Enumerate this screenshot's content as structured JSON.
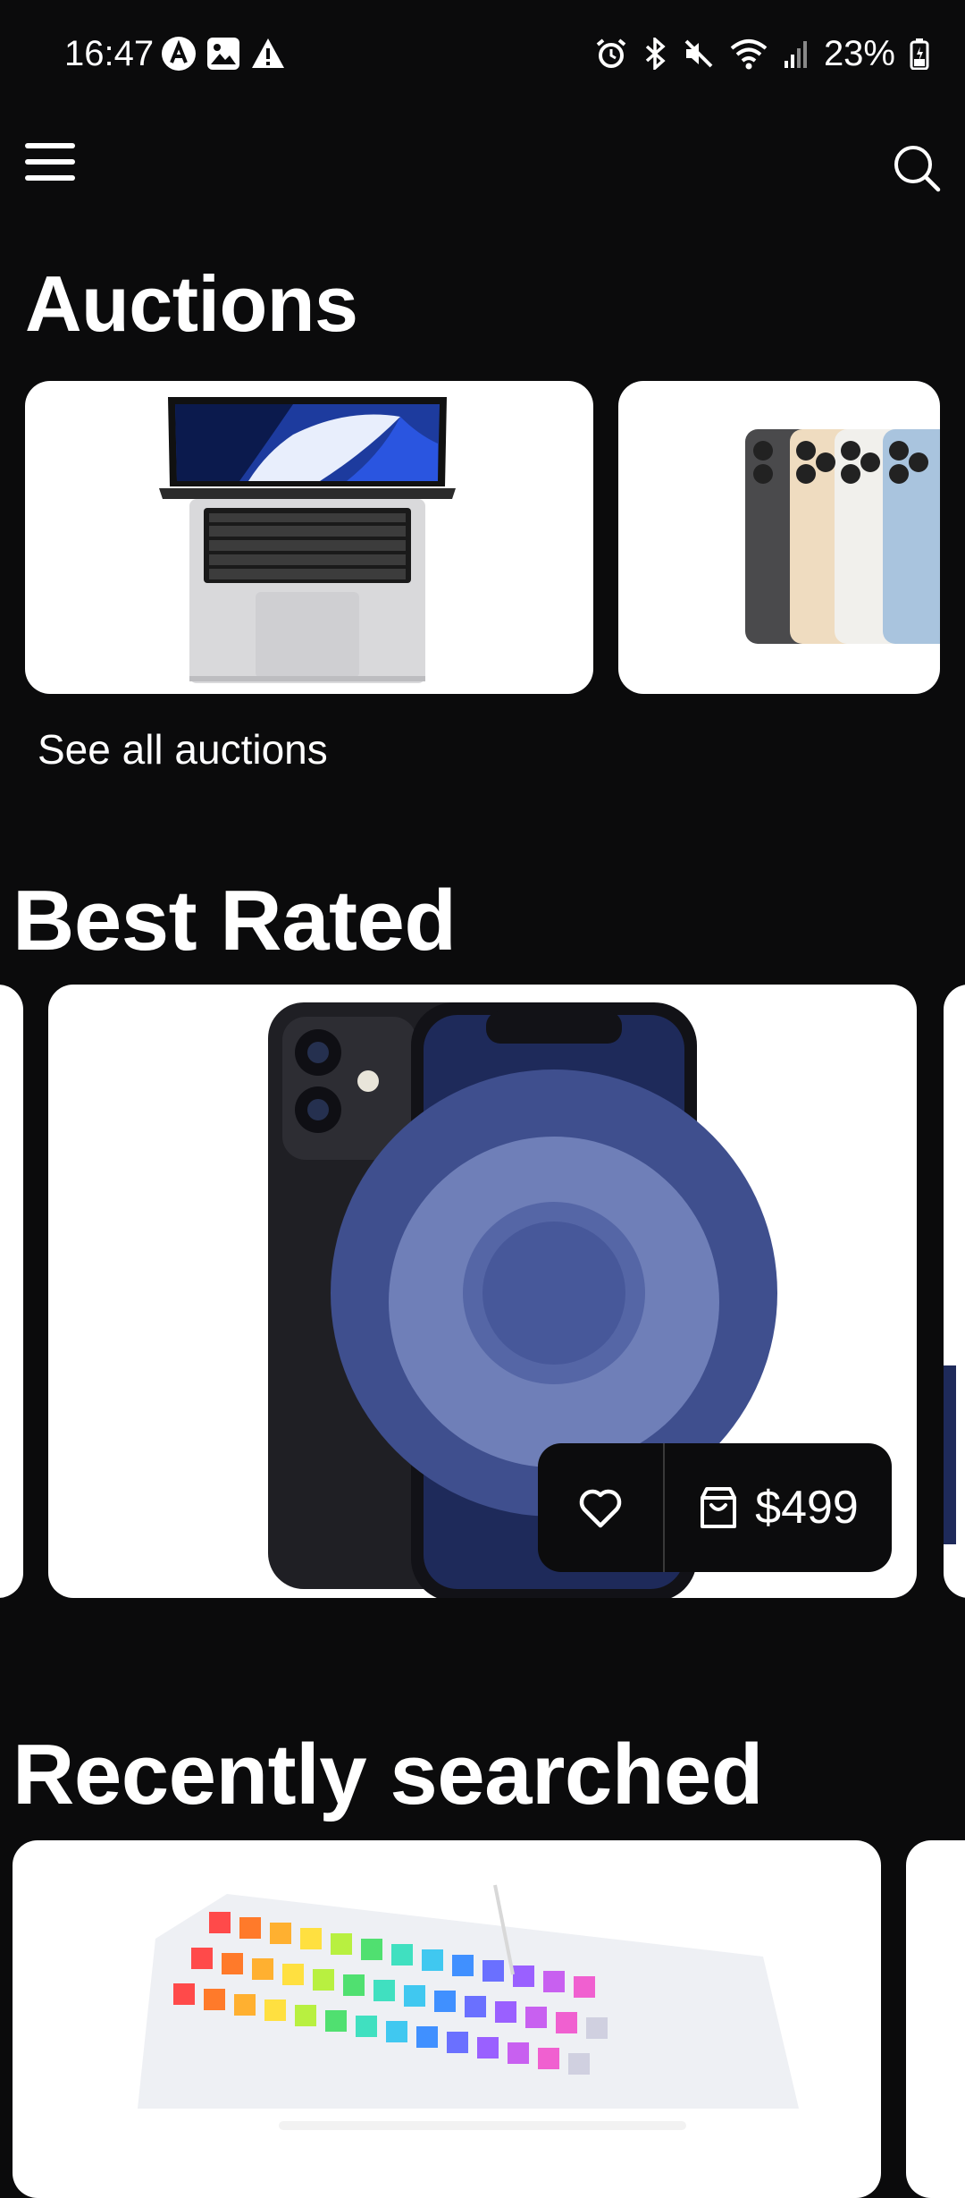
{
  "status_bar": {
    "time": "16:47",
    "battery": "23%",
    "left_icons": [
      "app-notification-icon",
      "gallery-icon",
      "warning-icon"
    ],
    "right_icons": [
      "alarm-icon",
      "bluetooth-icon",
      "mute-icon",
      "wifi-icon",
      "signal-icon",
      "battery-icon"
    ]
  },
  "app_bar": {
    "menu_icon": "hamburger-menu-icon",
    "search_icon": "search-icon"
  },
  "auctions": {
    "title": "Auctions",
    "items": [
      {
        "image": "macbook-pro-image"
      },
      {
        "image": "iphone-13-pro-colors-image"
      }
    ],
    "see_all_label": "See all auctions"
  },
  "best_rated": {
    "title": "Best Rated",
    "items": [
      {
        "image": "iphone-12-image",
        "price": "$499"
      }
    ],
    "favorite_icon": "heart-icon",
    "cart_icon": "shopping-bag-icon"
  },
  "recently_searched": {
    "title": "Recently searched",
    "items": [
      {
        "image": "rgb-keyboard-image"
      }
    ]
  },
  "colors": {
    "background": "#0b0b0c",
    "card": "#ffffff",
    "text": "#ffffff"
  }
}
